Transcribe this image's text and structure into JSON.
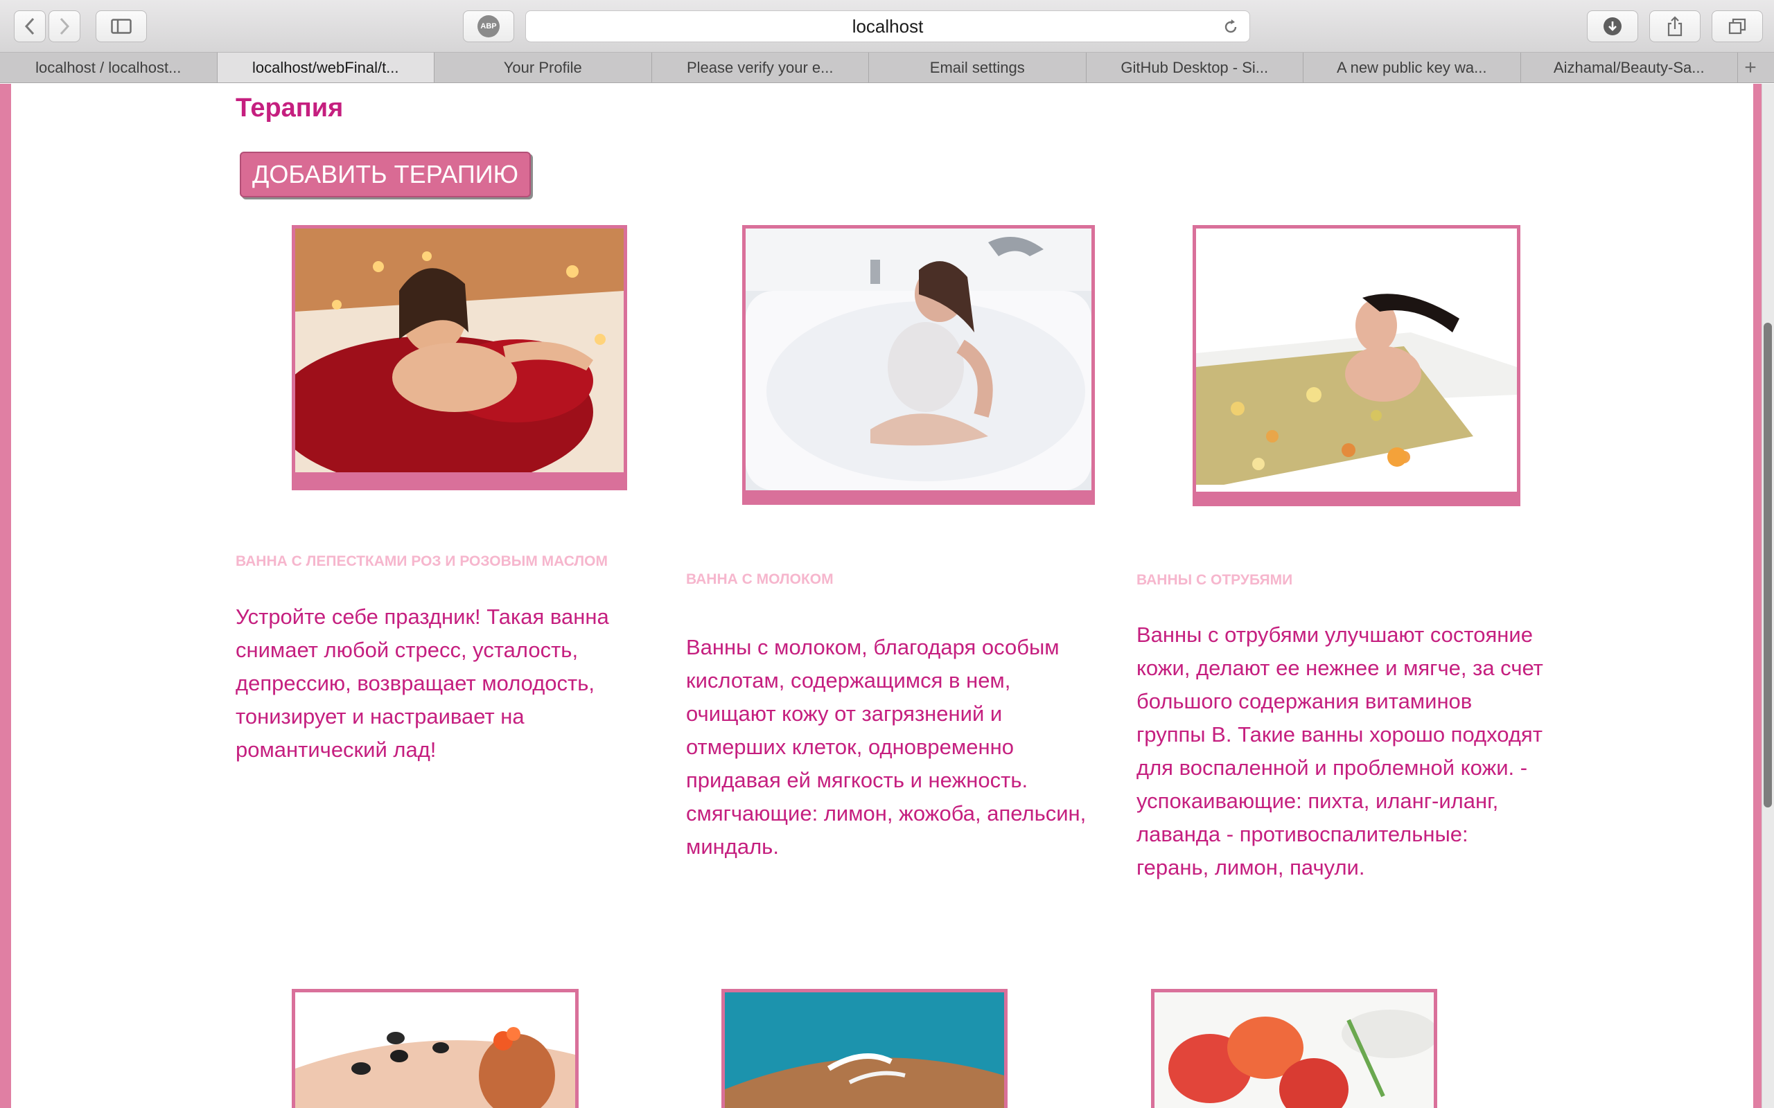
{
  "browser": {
    "url": "localhost",
    "adblock_badge": "ABP",
    "tabs": [
      {
        "label": "localhost / localhost..."
      },
      {
        "label": "localhost/webFinal/t..."
      },
      {
        "label": "Your Profile"
      },
      {
        "label": "Please verify your e..."
      },
      {
        "label": "Email settings"
      },
      {
        "label": "GitHub Desktop - Si..."
      },
      {
        "label": "A new public key wa..."
      },
      {
        "label": "Aizhamal/Beauty-Sa..."
      }
    ],
    "add_tab_symbol": "+"
  },
  "page": {
    "title": "Терапия",
    "add_button_label": "ДОБАВИТЬ ТЕРАПИЮ",
    "therapies": [
      {
        "name": "ВАННА С ЛЕПЕСТКАМИ РОЗ И РОЗОВЫМ МАСЛОМ",
        "description": "Устройте себе праздник! Такая ванна снимает любой стресс, усталость, депрессию, возвращает молодость, тонизирует и настраивает на романтический лад!"
      },
      {
        "name": "ВАННА С МОЛОКОМ",
        "description": "Ванны с молоком, благодаря особым кислотам, содержащимся в нем, очищают кожу от загрязнений и отмерших клеток, одновременно придавая ей мягкость и нежность. смягчающие: лимон, жожоба, апельсин, миндаль."
      },
      {
        "name": "ВАННЫ С ОТРУБЯМИ",
        "description": "Ванны с отрубями улучшают состояние кожи, делают ее нежнее и мягче, за счет большого содержания витаминов группы В. Такие ванны хорошо подходят для воспаленной и проблемной кожи. - успокаивающие: пихта, иланг-иланг, лаванда - противоспалительные: герань, лимон, пачули."
      }
    ]
  },
  "colors": {
    "accent": "#c51f7f",
    "frame": "#d9709a",
    "name_text": "#f6b6cd",
    "button_bg": "#d96b94"
  }
}
